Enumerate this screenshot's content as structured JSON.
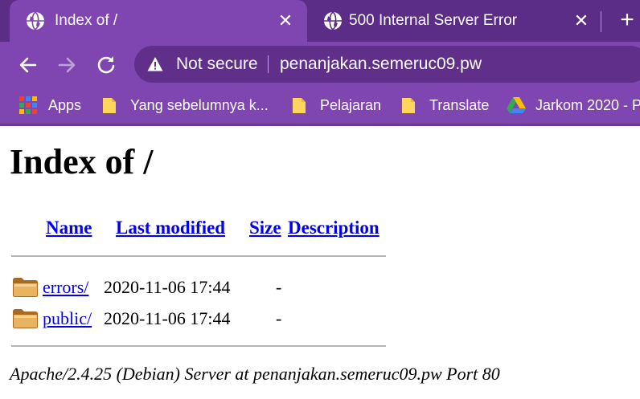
{
  "tabs": [
    {
      "title": "Index of /",
      "active": true,
      "icon": "globe-icon"
    },
    {
      "title": "500 Internal Server Error",
      "active": false,
      "icon": "globe-icon"
    }
  ],
  "toolbar": {
    "security_label": "Not secure",
    "url": "penanjakan.semeruc09.pw"
  },
  "bookmarks": [
    {
      "label": "Apps",
      "icon": "apps-grid-icon"
    },
    {
      "label": "Yang sebelumnya k...",
      "icon": "folder-icon"
    },
    {
      "label": "Pelajaran",
      "icon": "folder-icon"
    },
    {
      "label": "Translate",
      "icon": "folder-icon"
    },
    {
      "label": "Jarkom 2020 - P",
      "icon": "google-drive-icon"
    }
  ],
  "page": {
    "heading": "Index of /",
    "columns": {
      "name": "Name",
      "last_modified": "Last modified",
      "size": "Size",
      "description": "Description"
    },
    "rows": [
      {
        "name": "errors/",
        "modified": "2020-11-06 17:44",
        "size": "-",
        "icon": "folder-icon"
      },
      {
        "name": "public/",
        "modified": "2020-11-06 17:44",
        "size": "-",
        "icon": "folder-icon"
      }
    ],
    "footer": "Apache/2.4.25 (Debian) Server at penanjakan.semeruc09.pw Port 80"
  },
  "colors": {
    "tabstrip": "#5b2d87",
    "toolbar": "#7f45b0",
    "omnibox": "#5f2f8a",
    "link": "#0000ee",
    "folder": "#d9a85c"
  }
}
